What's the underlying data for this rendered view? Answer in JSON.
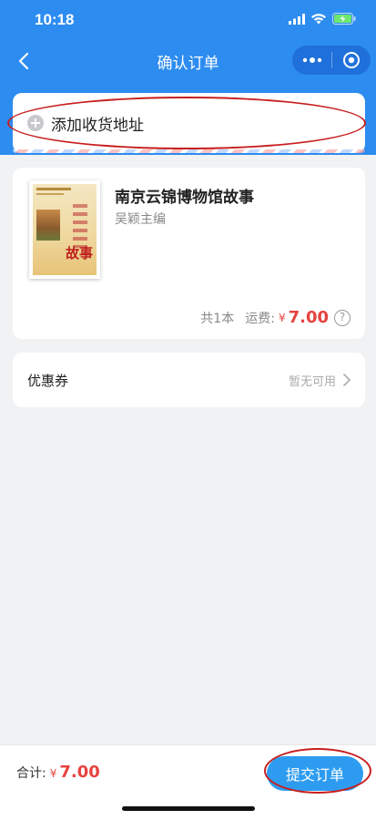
{
  "status_bar": {
    "time": "10:18",
    "icons": [
      "signal-icon",
      "wifi-icon",
      "battery-charging-icon"
    ]
  },
  "nav": {
    "title": "确认订单",
    "back_icon": "chevron-left-icon",
    "capsule_icons": [
      "more-dots-icon",
      "close-target-icon"
    ]
  },
  "address": {
    "label": "添加收货地址",
    "icon": "plus-circle-icon"
  },
  "product": {
    "title": "南京云锦博物馆故事",
    "author": "吴颖主编",
    "cover_char": "故事",
    "count_text": "共1本",
    "shipping_label": "运费:",
    "currency": "¥",
    "shipping_amount": "7.00",
    "help_glyph": "?"
  },
  "coupon": {
    "label": "优惠券",
    "value": "暂无可用"
  },
  "footer": {
    "total_label": "合计:",
    "currency": "¥",
    "total_amount": "7.00",
    "submit_label": "提交订单"
  },
  "colors": {
    "primary_blue": "#2d8cf0",
    "price_red": "#e64340",
    "annotation_red": "#c81e1e"
  }
}
